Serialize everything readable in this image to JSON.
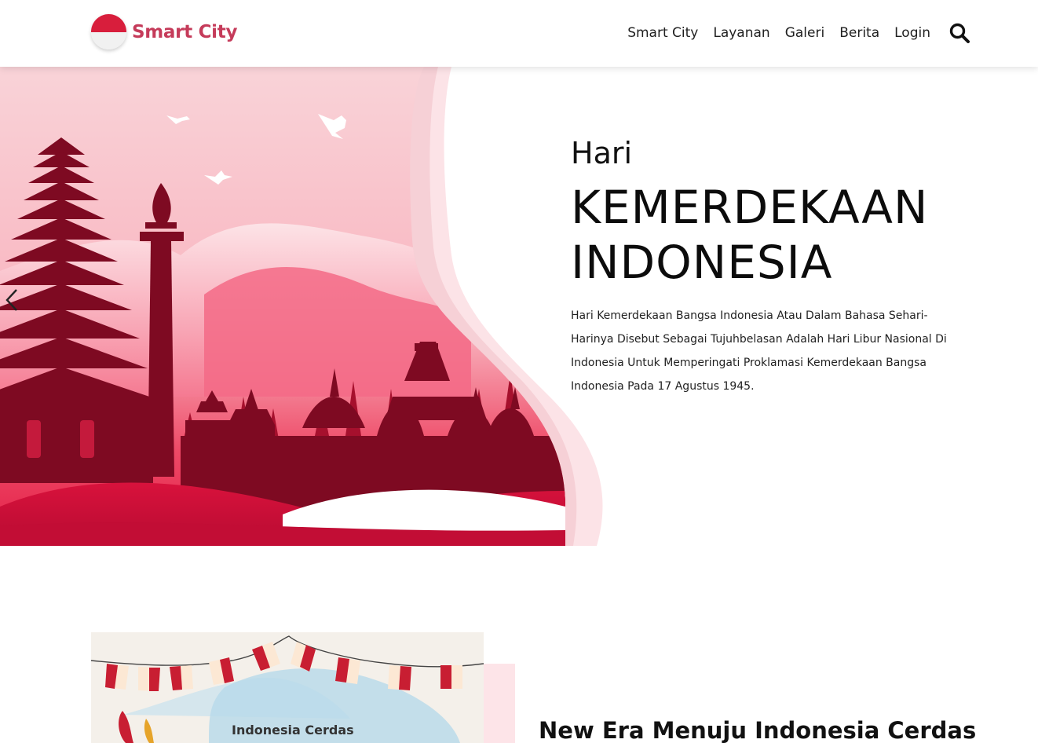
{
  "brand": {
    "name": "Smart City"
  },
  "nav": {
    "items": [
      "Smart City",
      "Layanan",
      "Galeri",
      "Berita",
      "Login"
    ],
    "search_icon": "search-icon"
  },
  "hero": {
    "pre_title": "Hari",
    "title_line1": "KEMERDEKAAN",
    "title_line2": "INDONESIA",
    "description": "Hari Kemerdekaan Bangsa Indonesia Atau Dalam Bahasa Sehari-Harinya Disebut Sebagai Tujuhbelasan Adalah Hari Libur Nasional Di Indonesia Untuk Memperingati Proklamasi Kemerdekaan Bangsa Indonesia Pada 17 Agustus 1945.",
    "prev_icon": "chevron-left-icon"
  },
  "section": {
    "card_title": "Indonesia Cerdas",
    "heading": "New Era Menuju Indonesia Cerdas"
  },
  "colors": {
    "brand": "#c53b5a",
    "flag_red": "#d81e3c",
    "silhouette": "#7e0a22"
  }
}
